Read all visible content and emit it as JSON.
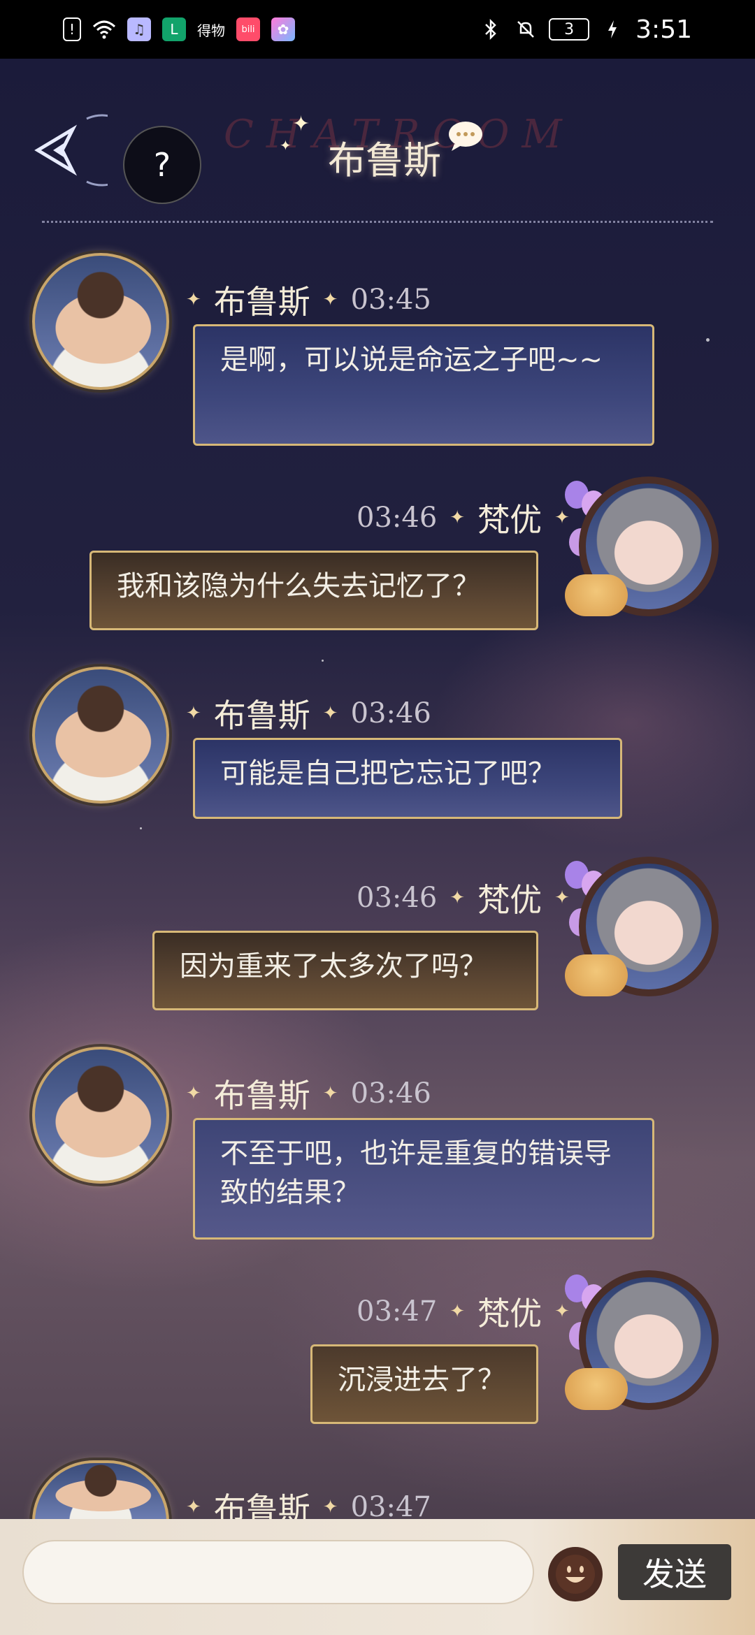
{
  "status_bar": {
    "time": "3:51",
    "battery": "3",
    "apps": [
      {
        "name": "alert-app-icon",
        "glyph": "!"
      },
      {
        "name": "wifi-icon",
        "glyph": "📶"
      },
      {
        "name": "music-app-icon",
        "glyph": "♫"
      },
      {
        "name": "green-app-icon",
        "glyph": "L"
      },
      {
        "name": "deyi-app-icon",
        "glyph": "得物"
      },
      {
        "name": "bilibili-app-icon",
        "glyph": "bili"
      },
      {
        "name": "colorful-app-icon",
        "glyph": "✿"
      }
    ]
  },
  "header": {
    "title": "布鲁斯",
    "background_text": "CHATROOM",
    "help_label": "?"
  },
  "messages": [
    {
      "side": "left",
      "name": "布鲁斯",
      "time": "03:45",
      "text": "是啊，可以说是命运之子吧~~"
    },
    {
      "side": "right",
      "name": "梵优",
      "time": "03:46",
      "text": "我和该隐为什么失去记忆了？"
    },
    {
      "side": "left",
      "name": "布鲁斯",
      "time": "03:46",
      "text": "可能是自己把它忘记了吧？"
    },
    {
      "side": "right",
      "name": "梵优",
      "time": "03:46",
      "text": "因为重来了太多次了吗？"
    },
    {
      "side": "left",
      "name": "布鲁斯",
      "time": "03:46",
      "text": "不至于吧，也许是重复的错误导致的结果？"
    },
    {
      "side": "right",
      "name": "梵优",
      "time": "03:47",
      "text": "沉浸进去了？"
    },
    {
      "side": "left",
      "name": "布鲁斯",
      "time": "03:47",
      "text": ""
    }
  ],
  "composer": {
    "input_value": "",
    "send_label": "发送"
  },
  "colors": {
    "bubble_left": "#2c3466",
    "bubble_right": "#5a4532",
    "bubble_border": "#d7b877"
  }
}
